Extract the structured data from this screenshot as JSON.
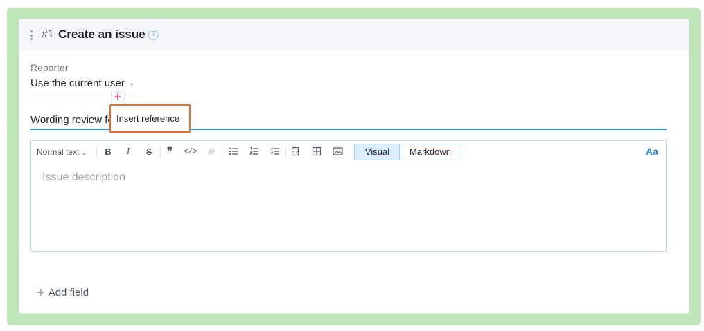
{
  "step": {
    "number": "#1",
    "title": "Create an issue",
    "help_icon": "question-circle-icon"
  },
  "reporter": {
    "label": "Reporter",
    "value": "Use the current user"
  },
  "title_field": {
    "value": "Wording review fo"
  },
  "tooltip": {
    "label": "Insert reference"
  },
  "editor": {
    "format_select": "Normal text",
    "toolbar_icons": [
      "bold-icon",
      "italic-icon",
      "strikethrough-icon",
      "quote-icon",
      "code-icon",
      "link-icon",
      "bullet-list-icon",
      "numbered-list-icon",
      "task-list-icon",
      "code-block-icon",
      "table-icon",
      "image-icon"
    ],
    "bold_glyph": "B",
    "italic_glyph": "I",
    "strike_glyph": "S",
    "quote_glyph": "❞",
    "code_glyph": "</>",
    "modes": [
      "Visual",
      "Markdown"
    ],
    "active_mode": "Visual",
    "font_button": "Aa",
    "placeholder": "Issue description"
  },
  "add_field": {
    "label": "Add field"
  },
  "colors": {
    "outer_highlight": "#bfe6b8",
    "accent": "#2f8ae0",
    "tooltip_border": "#e26d2c",
    "insert_plus": "#e0306e"
  }
}
